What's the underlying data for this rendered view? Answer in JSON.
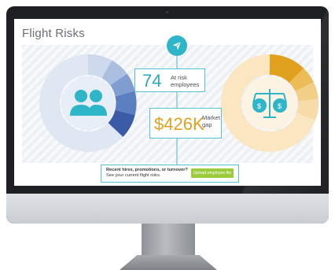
{
  "app": {
    "title": "Flight Risks"
  },
  "metrics": {
    "at_risk_count": "74",
    "at_risk_label_1": "At risk",
    "at_risk_label_2": "employees",
    "market_gap_value": "$426K",
    "market_gap_label_1": "Market",
    "market_gap_label_2": "gap"
  },
  "cta": {
    "line1": "Recent hires, promotions, or turnover?",
    "line2": "See your current flight risks.",
    "button_label": "Upload employee file"
  },
  "colors": {
    "accent_teal": "#2fb5c8",
    "blue_dark": "#3b5ba6",
    "blue_light": "#dfe7f2",
    "gold_dark": "#e0a21e",
    "gold_light": "#fbe6c2",
    "button_green": "#9ccb3c"
  },
  "icons": {
    "top": "paper-plane-icon",
    "left": "people-icon",
    "right": "scales-icon"
  }
}
